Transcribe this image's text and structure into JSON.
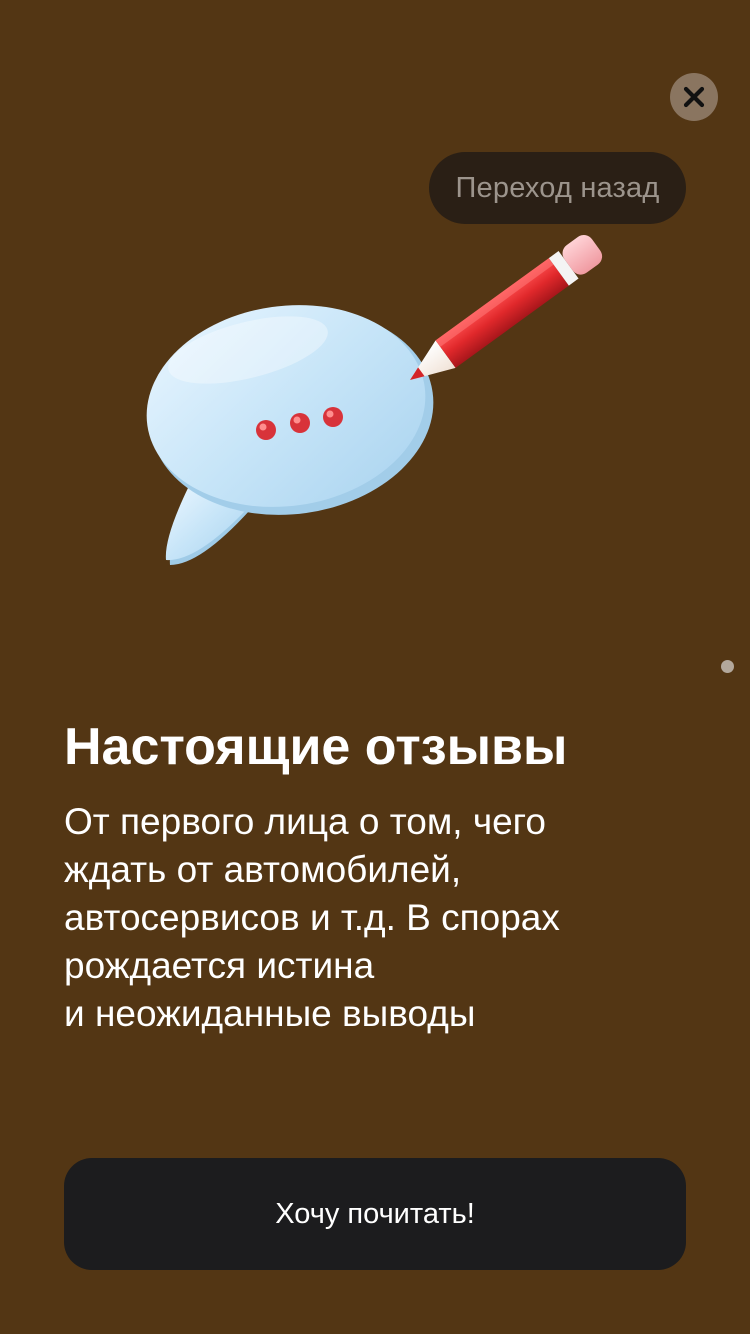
{
  "top_bar": {
    "close_icon": "close-icon",
    "back_button_label": "Переход назад"
  },
  "illustration": {
    "icon": "speech-bubble-pencil-icon"
  },
  "pagination": {
    "dot_icon": "page-indicator-dot"
  },
  "content": {
    "title": "Настоящие отзывы",
    "description_lines": [
      "От первого лица о том, чего",
      "ждать от автомобилей,",
      "автосервисов и т.д. В спорах",
      "рождается истина",
      "и неожиданные выводы"
    ]
  },
  "cta": {
    "label": "Хочу почитать!"
  },
  "colors": {
    "background": "#533614",
    "close_button": "#8a7560",
    "back_pill": "#2a1f15",
    "cta_background": "#1c1c1e"
  }
}
